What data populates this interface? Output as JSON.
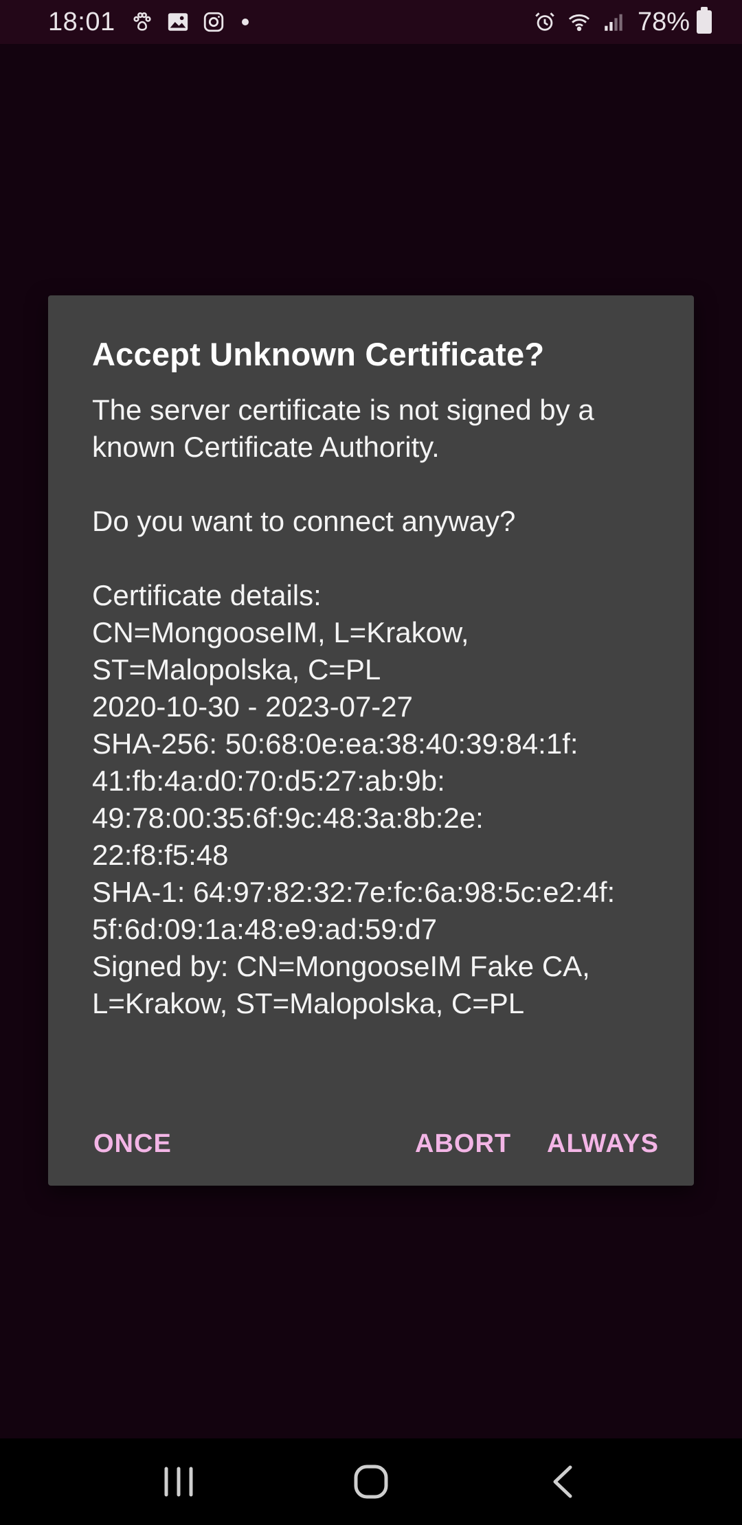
{
  "status_bar": {
    "time": "18:01",
    "notification_icons": [
      "paw-icon",
      "gallery-icon",
      "instagram-icon"
    ],
    "system_icons": [
      "alarm-icon",
      "wifi-icon",
      "signal-icon",
      "battery-icon"
    ],
    "battery_percent": "78%"
  },
  "dialog": {
    "title": "Accept Unknown Certificate?",
    "message": {
      "intro_line1": "The server certificate is not signed by a",
      "intro_line2": "known Certificate Authority.",
      "question": "Do you want to connect anyway?",
      "details_label": "Certificate details:",
      "subject_line1": "CN=MongooseIM, L=Krakow,",
      "subject_line2": "ST=Malopolska, C=PL",
      "validity": "2020-10-30 - 2023-07-27",
      "sha256_line1": "SHA-256: 50:68:0e:ea:38:40:39:84:1f:",
      "sha256_line2": "41:fb:4a:d0:70:d5:27:ab:9b:",
      "sha256_line3": "49:78:00:35:6f:9c:48:3a:8b:2e:",
      "sha256_line4": "22:f8:f5:48",
      "sha1_line1": "SHA-1: 64:97:82:32:7e:fc:6a:98:5c:e2:4f:",
      "sha1_line2": "5f:6d:09:1a:48:e9:ad:59:d7",
      "signer_line1": "Signed by: CN=MongooseIM Fake CA,",
      "signer_line2": "L=Krakow, ST=Malopolska, C=PL"
    },
    "buttons": {
      "once": "ONCE",
      "abort": "ABORT",
      "always": "ALWAYS"
    },
    "accent_color": "#f3b5e6",
    "background_color": "#424242"
  },
  "nav_bar": {
    "icons": [
      "recents-icon",
      "home-icon",
      "back-icon"
    ]
  },
  "colors": {
    "screen_background": "#13030f",
    "status_bar_background": "#230718"
  }
}
